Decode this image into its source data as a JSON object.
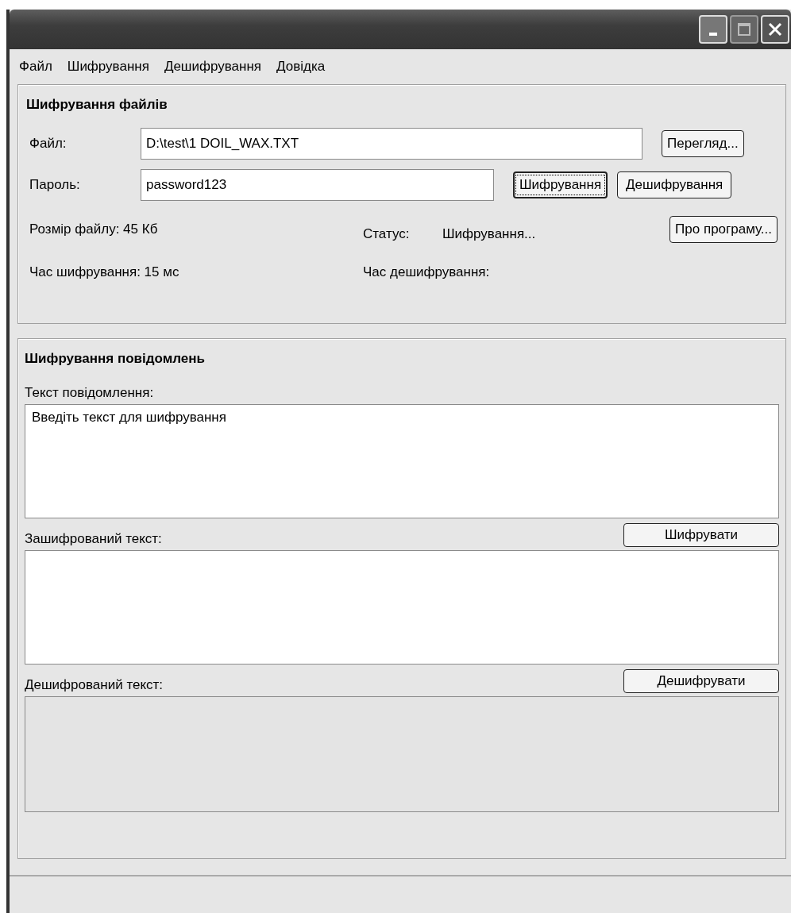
{
  "menu": [
    {
      "label": "Файл"
    },
    {
      "label": "Шифрування"
    },
    {
      "label": "Дешифрування"
    },
    {
      "label": "Довідка"
    }
  ],
  "file_encryption": {
    "title": "Шифрування файлів",
    "file": {
      "label": "Файл:",
      "value": "D:\\test\\1 DOIL_WAX.TXT",
      "button": "Перегляд..."
    },
    "password": {
      "label": "Пароль:",
      "value": "password123"
    },
    "buttons": [
      {
        "label": "Шифрування",
        "focused": true
      },
      {
        "label": "Дешифрування",
        "focused": false
      }
    ],
    "size": {
      "label": "Розмір файлу:",
      "value": "45 Кб"
    },
    "status": {
      "label": "Статус:",
      "value": "Шифрування..."
    },
    "about_button": "Про програму...",
    "encrypt_time": {
      "label": "Час шифрування:",
      "value": "15 мс"
    },
    "decrypt_time": {
      "label": "Час дешифрування:"
    }
  },
  "message_encryption": {
    "title": "Шифрування повідомлень",
    "areas": [
      {
        "label": "Текст повідомлення:",
        "value": "Введіть текст для шифрування",
        "disabled": false
      },
      {
        "label": "Зашифрований текст:",
        "button": "Шифрувати",
        "disabled": false
      },
      {
        "label": "Дешифрований текст:",
        "button": "Дешифрувати",
        "disabled": true
      }
    ]
  }
}
